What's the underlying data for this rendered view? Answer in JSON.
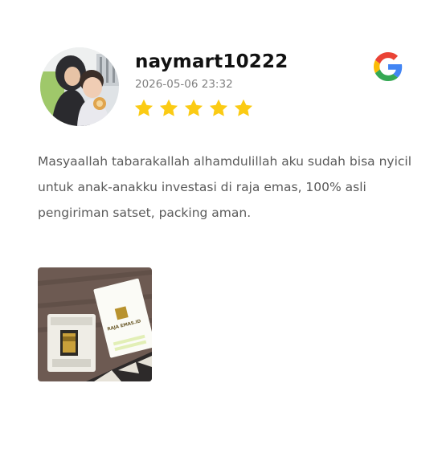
{
  "review": {
    "username": "naymart10222",
    "date": "2026-05-06 23:32",
    "rating": 5,
    "rating_max": 5,
    "text": "Masyaallah tabarakallah alhamdulillah aku sudah bisa nyicil untuk anak-anakku investasi di raja emas, 100% asli pengiriman satset, packing aman.",
    "source_icon": "google-icon",
    "star_color": "#fbcb14"
  },
  "photo": {
    "card_brand": "RAJA EMAS.ID"
  }
}
